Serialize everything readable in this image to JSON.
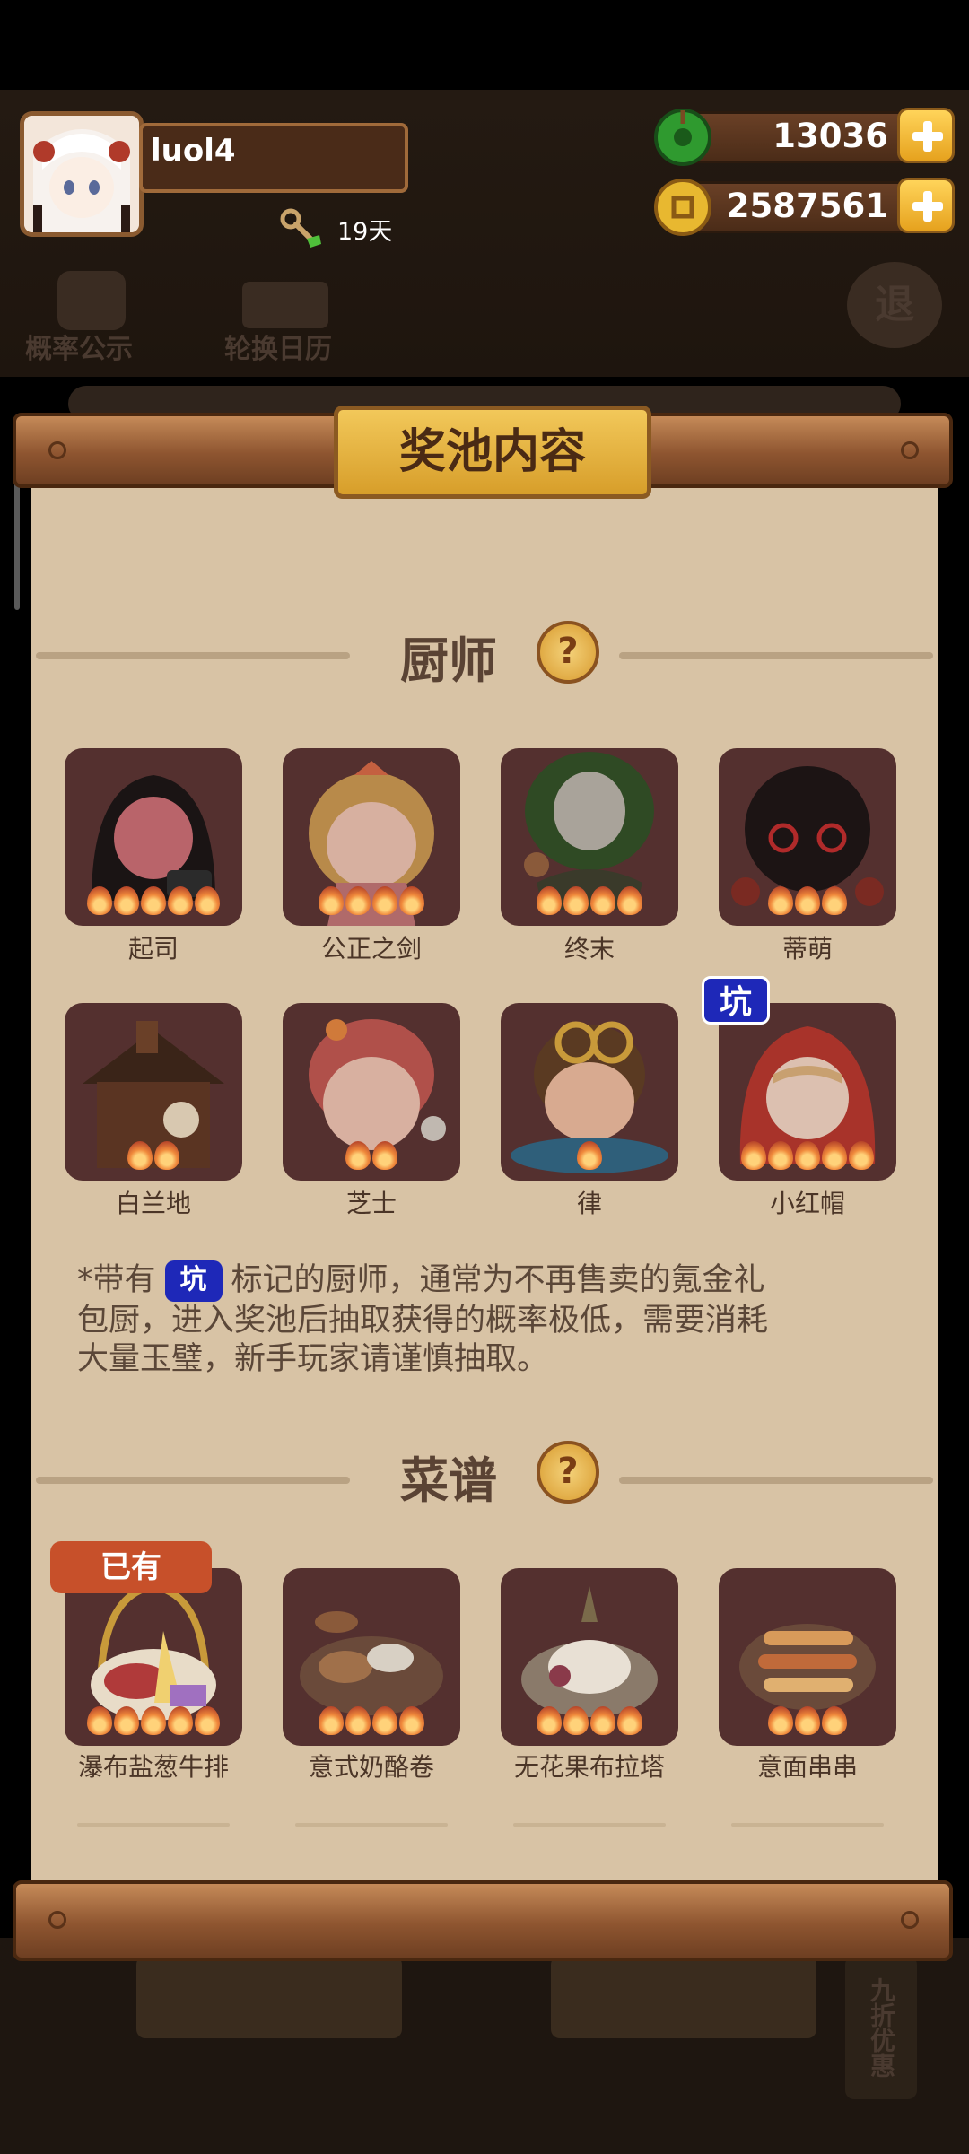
{
  "profile": {
    "name": "luol4",
    "days": "19天"
  },
  "currency": {
    "jade": "13036",
    "gold": "2587561"
  },
  "bg_menu": {
    "probability": "概率公示",
    "calendar": "轮换日历",
    "exit": "退"
  },
  "panel": {
    "title": "奖池内容",
    "chefs_section": "厨师",
    "chefs": [
      {
        "name": "起司",
        "stars": 5
      },
      {
        "name": "公正之剑",
        "stars": 4
      },
      {
        "name": "终末",
        "stars": 4
      },
      {
        "name": "蒂萌",
        "stars": 3
      },
      {
        "name": "白兰地",
        "stars": 2
      },
      {
        "name": "芝士",
        "stars": 2
      },
      {
        "name": "律",
        "stars": 1
      },
      {
        "name": "小红帽",
        "stars": 5
      }
    ],
    "keng_tag": "坑",
    "note_prefix": "*带有",
    "note_line1": "标记的厨师，通常为不再售卖的氪金礼",
    "note_line2": "包厨，进入奖池后抽取获得的概率极低，需要消耗",
    "note_line3": "大量玉璧，新手玩家请谨慎抽取。",
    "recipes_section": "菜谱",
    "owned_tag": "已有",
    "recipes": [
      {
        "name": "瀑布盐葱牛排",
        "stars": 5
      },
      {
        "name": "意式奶酪卷",
        "stars": 4
      },
      {
        "name": "无花果布拉塔",
        "stars": 4
      },
      {
        "name": "意面串串",
        "stars": 3
      }
    ]
  },
  "bottom_side": "九折优惠"
}
